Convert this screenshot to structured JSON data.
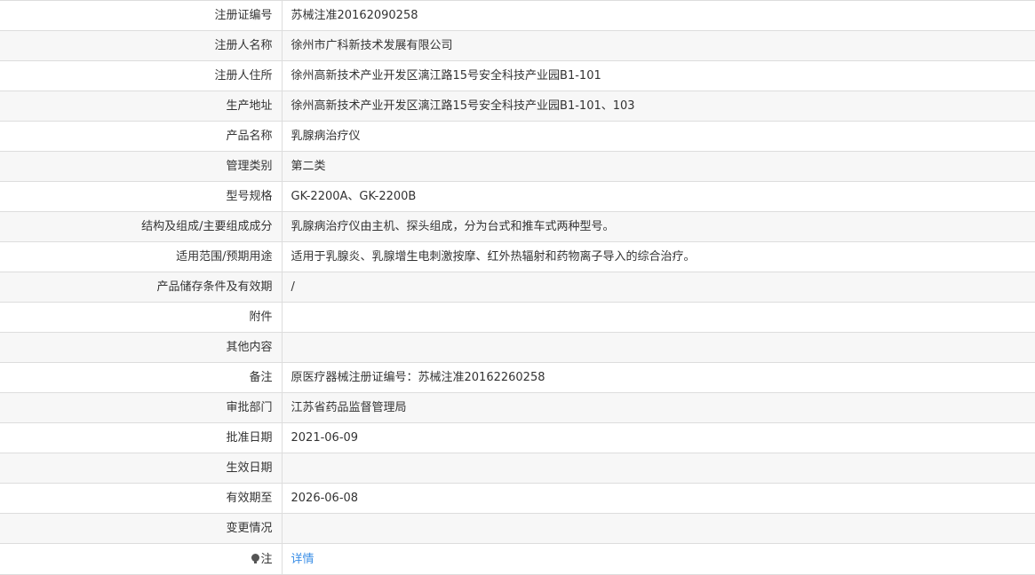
{
  "rows": [
    {
      "label": "注册证编号",
      "value": "苏械注准20162090258"
    },
    {
      "label": "注册人名称",
      "value": "徐州市广科新技术发展有限公司"
    },
    {
      "label": "注册人住所",
      "value": "徐州高新技术产业开发区漓江路15号安全科技产业园B1-101"
    },
    {
      "label": "生产地址",
      "value": "徐州高新技术产业开发区漓江路15号安全科技产业园B1-101、103"
    },
    {
      "label": "产品名称",
      "value": "乳腺病治疗仪"
    },
    {
      "label": "管理类别",
      "value": "第二类"
    },
    {
      "label": "型号规格",
      "value": "GK-2200A、GK-2200B"
    },
    {
      "label": "结构及组成/主要组成成分",
      "value": "乳腺病治疗仪由主机、探头组成，分为台式和推车式两种型号。"
    },
    {
      "label": "适用范围/预期用途",
      "value": "适用于乳腺炎、乳腺增生电刺激按摩、红外热辐射和药物离子导入的综合治疗。"
    },
    {
      "label": "产品储存条件及有效期",
      "value": "/"
    },
    {
      "label": "附件",
      "value": ""
    },
    {
      "label": "其他内容",
      "value": ""
    },
    {
      "label": "备注",
      "value": "原医疗器械注册证编号：苏械注准20162260258"
    },
    {
      "label": "审批部门",
      "value": "江苏省药品监督管理局"
    },
    {
      "label": "批准日期",
      "value": "2021-06-09"
    },
    {
      "label": "生效日期",
      "value": ""
    },
    {
      "label": "有效期至",
      "value": "2026-06-08"
    },
    {
      "label": "变更情况",
      "value": ""
    }
  ],
  "note": {
    "label": "注",
    "icon": "bulb-icon",
    "link_text": "详情"
  }
}
